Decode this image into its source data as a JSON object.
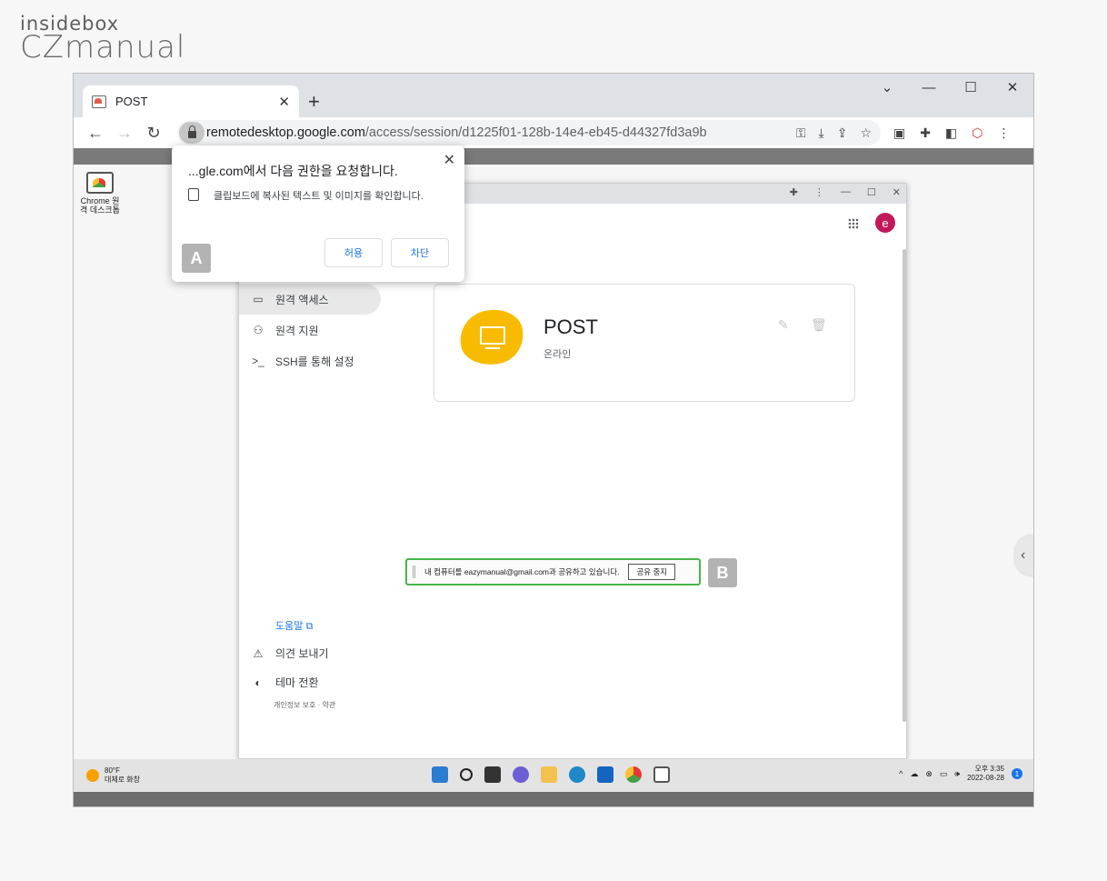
{
  "logo": {
    "line1": "insidebox",
    "line2": "CZmanual"
  },
  "browser": {
    "tab_title": "POST",
    "tab_close": "✕",
    "new_tab": "+",
    "url_host": "remotedesktop.google.com",
    "url_path": "/access/session/d1225f01-128b-14e4-eb45-d44327fd3a9b"
  },
  "desktop_icon_label": "Chrome 원격 데스크톱",
  "permission_popup": {
    "title": "...gle.com에서 다음 권한을 요청합니다.",
    "text": "클립보드에 복사된 텍스트 및 이미지를 확인합니다.",
    "allow_label": "허용",
    "block_label": "차단",
    "badge": "A"
  },
  "inner": {
    "avatar_letter": "e",
    "nav": [
      {
        "label": "원격 액세스",
        "icon": "laptop-icon"
      },
      {
        "label": "원격 지원",
        "icon": "people-icon"
      },
      {
        "label": "SSH를 통해 설정",
        "icon": "terminal-icon"
      }
    ],
    "card": {
      "title": "POST",
      "status": "온라인"
    },
    "share_bar": {
      "text": "내 컴퓨터를 eazymanual@gmail.com과 공유하고 있습니다.",
      "stop_label": "공유 중지",
      "badge": "B"
    },
    "help_label": "도움말",
    "feedback_label": "의견 보내기",
    "theme_label": "테마 전환",
    "legal_text": "개인정보 보호 · 약관"
  },
  "taskbar": {
    "temp": "80°F",
    "weather": "대체로 화창",
    "time": "오후 3:35",
    "date": "2022-08-28",
    "notif_count": "1"
  },
  "colors": {
    "accent": "#1a73e8",
    "card_blob": "#f9bb00",
    "avatar": "#c2185b",
    "share_border": "#46b64a"
  }
}
